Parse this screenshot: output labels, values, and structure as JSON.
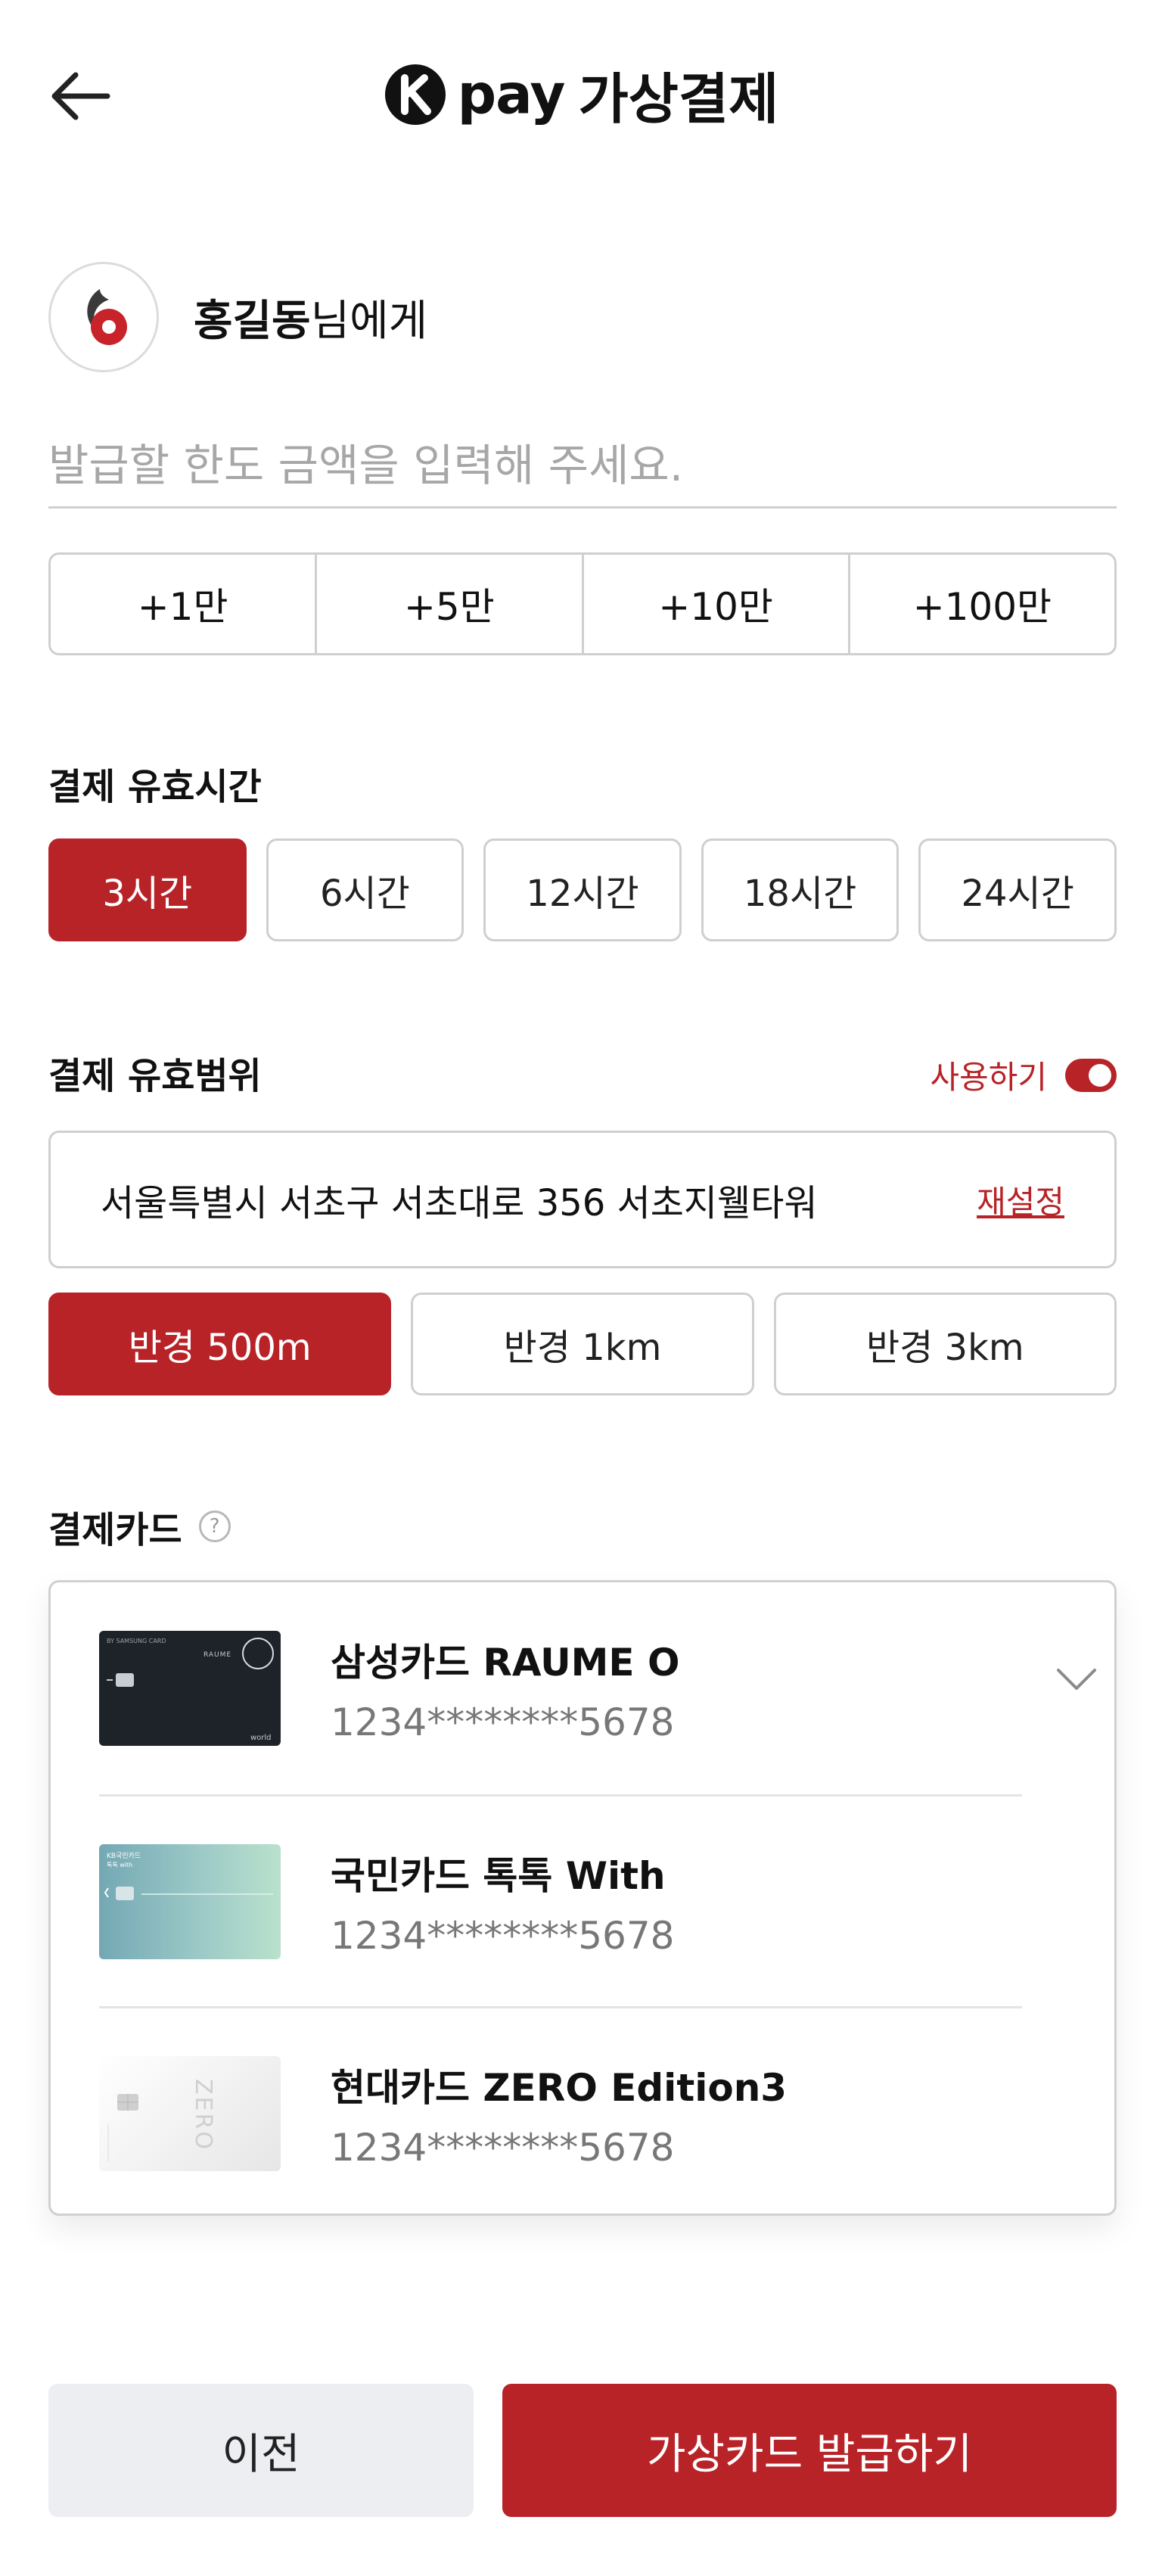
{
  "header": {
    "back_icon": "arrow-left-icon",
    "brand_logo": "kakao-k-icon",
    "brand_pay": "pay",
    "title": "가상결제"
  },
  "recipient": {
    "avatar_icon": "user-logo-icon",
    "name": "홍길동",
    "suffix": "님에게"
  },
  "amount": {
    "placeholder": "발급할 한도 금액을 입력해 주세요.",
    "value": ""
  },
  "quick_add": [
    {
      "label": "+1만"
    },
    {
      "label": "+5만"
    },
    {
      "label": "+10만"
    },
    {
      "label": "+100만"
    }
  ],
  "valid_time": {
    "title": "결제 유효시간",
    "options": [
      {
        "label": "3시간",
        "selected": true
      },
      {
        "label": "6시간",
        "selected": false
      },
      {
        "label": "12시간",
        "selected": false
      },
      {
        "label": "18시간",
        "selected": false
      },
      {
        "label": "24시간",
        "selected": false
      }
    ]
  },
  "valid_range": {
    "title": "결제 유효범위",
    "use_label": "사용하기",
    "use_enabled": true,
    "address": "서울특별시 서초구 서초대로 356 서초지웰타워",
    "reset_label": "재설정",
    "radius_options": [
      {
        "label": "반경 500m",
        "selected": true
      },
      {
        "label": "반경 1km",
        "selected": false
      },
      {
        "label": "반경 3km",
        "selected": false
      }
    ]
  },
  "payment_card": {
    "title": "결제카드",
    "help_icon": "question-circle-icon",
    "chevron_icon": "chevron-down-icon",
    "cards": [
      {
        "name": "삼성카드 RAUME O",
        "number": "1234********5678",
        "art": {
          "issuer": "BY SAMSUNG CARD",
          "brand": "RAUME",
          "network": "world"
        }
      },
      {
        "name": "국민카드 톡톡 With",
        "number": "1234********5678",
        "art": {
          "issuer": "KB국민카드",
          "brand": "톡톡 with"
        }
      },
      {
        "name": "현대카드 ZERO Edition3",
        "number": "1234********5678",
        "art": {
          "brand": "ZERO"
        }
      }
    ]
  },
  "footer": {
    "prev_label": "이전",
    "issue_label": "가상카드 발급하기"
  },
  "colors": {
    "accent": "#b82328",
    "border": "#cfcfcf",
    "placeholder": "#a7a7a7",
    "muted_text": "#777777",
    "secondary_button_bg": "#eceef1"
  }
}
